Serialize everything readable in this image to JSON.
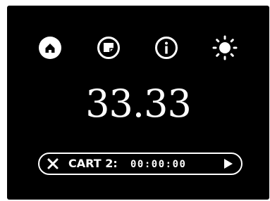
{
  "toolbar": {
    "icons": [
      "home-icon",
      "note-icon",
      "info-icon",
      "brightness-icon"
    ]
  },
  "display": {
    "value": "33.33"
  },
  "timer": {
    "close_icon": "close-icon",
    "cart_label": "CART 2:",
    "time": "00:00:00",
    "play_icon": "play-icon"
  },
  "colors": {
    "background": "#000000",
    "foreground": "#ffffff"
  }
}
